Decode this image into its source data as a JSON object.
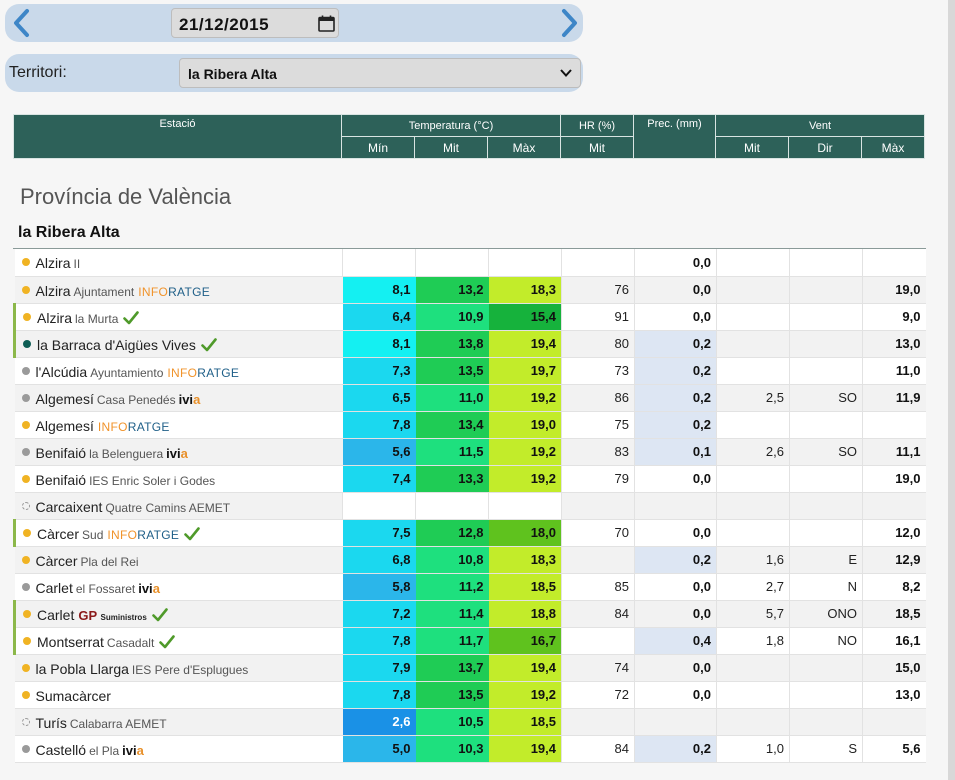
{
  "date": "21/12/2015",
  "territory": {
    "label": "Territori:",
    "selected": "la Ribera Alta"
  },
  "headers": {
    "station": "Estació",
    "temperature": "Temperatura (°C)",
    "hr": "HR (%)",
    "prec": "Prec. (mm)",
    "wind": "Vent",
    "min": "Mín",
    "mit": "Mit",
    "max": "Màx",
    "hr_mit": "Mit",
    "wind_mit": "Mit",
    "wind_dir": "Dir",
    "wind_max": "Màx"
  },
  "province": "Província de València",
  "region": "la Ribera Alta",
  "colors": {
    "header_bg": "#2d6159",
    "cyan": "#14f0f2",
    "sky": "#1bd8ef",
    "blue": "#2bb6ea",
    "deepblue": "#1a91e6",
    "green_light": "#1ee07e",
    "green": "#1fcc55",
    "green_dark": "#16b23c",
    "lime": "#c2ec2a",
    "lime_mid": "#93dc20",
    "lime_dark": "#5fc21e",
    "prec_shade": "#dde6f3"
  },
  "rows": [
    {
      "dot": "y",
      "station": "Alzira",
      "sub": "II",
      "net": "",
      "ok": false,
      "min": "",
      "mit": "",
      "max": "",
      "hr": "",
      "prec": "0,0",
      "wmit": "",
      "wdir": "",
      "wmax": "",
      "c": [
        "",
        "",
        ""
      ],
      "ps": false
    },
    {
      "dot": "y",
      "station": "Alzira",
      "sub": "Ajuntament",
      "net": "INFORATGE",
      "ok": false,
      "min": "8,1",
      "mit": "13,2",
      "max": "18,3",
      "hr": "76",
      "prec": "0,0",
      "wmit": "",
      "wdir": "",
      "wmax": "19,0",
      "c": [
        "cyan",
        "green",
        "lime"
      ],
      "ps": false
    },
    {
      "dot": "y",
      "station": "Alzira",
      "sub": "la Murta",
      "net": "",
      "ok": true,
      "min": "6,4",
      "mit": "10,9",
      "max": "15,4",
      "hr": "91",
      "prec": "0,0",
      "wmit": "",
      "wdir": "",
      "wmax": "9,0",
      "c": [
        "sky",
        "green_light",
        "green_dark"
      ],
      "ps": false
    },
    {
      "dot": "t",
      "station": "la Barraca d'Aigües Vives",
      "sub": "",
      "net": "",
      "ok": true,
      "min": "8,1",
      "mit": "13,8",
      "max": "19,4",
      "hr": "80",
      "prec": "0,2",
      "wmit": "",
      "wdir": "",
      "wmax": "13,0",
      "c": [
        "cyan",
        "green",
        "lime"
      ],
      "ps": true
    },
    {
      "dot": "g",
      "station": "l'Alcúdia",
      "sub": "Ayuntamiento",
      "net": "INFORATGE",
      "ok": false,
      "min": "7,3",
      "mit": "13,5",
      "max": "19,7",
      "hr": "73",
      "prec": "0,2",
      "wmit": "",
      "wdir": "",
      "wmax": "11,0",
      "c": [
        "sky",
        "green",
        "lime"
      ],
      "ps": true
    },
    {
      "dot": "g",
      "station": "Algemesí",
      "sub": "Casa Penedés",
      "net": "ivia",
      "ok": false,
      "min": "6,5",
      "mit": "11,0",
      "max": "19,2",
      "hr": "86",
      "prec": "0,2",
      "wmit": "2,5",
      "wdir": "SO",
      "wmax": "11,9",
      "c": [
        "sky",
        "green_light",
        "lime"
      ],
      "ps": true
    },
    {
      "dot": "y",
      "station": "Algemesí",
      "sub": "",
      "net": "INFORATGE",
      "ok": false,
      "min": "7,8",
      "mit": "13,4",
      "max": "19,0",
      "hr": "75",
      "prec": "0,2",
      "wmit": "",
      "wdir": "",
      "wmax": "",
      "c": [
        "sky",
        "green",
        "lime"
      ],
      "ps": true
    },
    {
      "dot": "g",
      "station": "Benifaió",
      "sub": "la Belenguera",
      "net": "ivia",
      "ok": false,
      "min": "5,6",
      "mit": "11,5",
      "max": "19,2",
      "hr": "83",
      "prec": "0,1",
      "wmit": "2,6",
      "wdir": "SO",
      "wmax": "11,1",
      "c": [
        "blue",
        "green_light",
        "lime"
      ],
      "ps": true
    },
    {
      "dot": "y",
      "station": "Benifaió",
      "sub": "IES Enric Soler i Godes",
      "net": "",
      "ok": false,
      "min": "7,4",
      "mit": "13,3",
      "max": "19,2",
      "hr": "79",
      "prec": "0,0",
      "wmit": "",
      "wdir": "",
      "wmax": "19,0",
      "c": [
        "sky",
        "green",
        "lime"
      ],
      "ps": false
    },
    {
      "dot": "e",
      "station": "Carcaixent",
      "sub": "Quatre Camins AEMET",
      "net": "",
      "ok": false,
      "min": "",
      "mit": "",
      "max": "",
      "hr": "",
      "prec": "",
      "wmit": "",
      "wdir": "",
      "wmax": "",
      "c": [
        "",
        "",
        ""
      ],
      "ps": false
    },
    {
      "dot": "y",
      "station": "Càrcer",
      "sub": "Sud",
      "net": "INFORATGE",
      "ok": true,
      "min": "7,5",
      "mit": "12,8",
      "max": "18,0",
      "hr": "70",
      "prec": "0,0",
      "wmit": "",
      "wdir": "",
      "wmax": "12,0",
      "c": [
        "sky",
        "green",
        "lime_dark"
      ],
      "ps": false
    },
    {
      "dot": "y",
      "station": "Càrcer",
      "sub": "Pla del Rei",
      "net": "",
      "ok": false,
      "min": "6,8",
      "mit": "10,8",
      "max": "18,3",
      "hr": "",
      "prec": "0,2",
      "wmit": "1,6",
      "wdir": "E",
      "wmax": "12,9",
      "c": [
        "sky",
        "green_light",
        "lime"
      ],
      "ps": true
    },
    {
      "dot": "g",
      "station": "Carlet",
      "sub": "el Fossaret",
      "net": "ivia",
      "ok": false,
      "min": "5,8",
      "mit": "11,2",
      "max": "18,5",
      "hr": "85",
      "prec": "0,0",
      "wmit": "2,7",
      "wdir": "N",
      "wmax": "8,2",
      "c": [
        "blue",
        "green_light",
        "lime"
      ],
      "ps": false
    },
    {
      "dot": "y",
      "station": "Carlet",
      "sub": "",
      "net": "GP",
      "ok": true,
      "min": "7,2",
      "mit": "11,4",
      "max": "18,8",
      "hr": "84",
      "prec": "0,0",
      "wmit": "5,7",
      "wdir": "ONO",
      "wmax": "18,5",
      "c": [
        "sky",
        "green_light",
        "lime"
      ],
      "ps": false
    },
    {
      "dot": "y",
      "station": "Montserrat",
      "sub": "Casadalt",
      "net": "",
      "ok": true,
      "min": "7,8",
      "mit": "11,7",
      "max": "16,7",
      "hr": "",
      "prec": "0,4",
      "wmit": "1,8",
      "wdir": "NO",
      "wmax": "16,1",
      "c": [
        "sky",
        "green_light",
        "lime_dark"
      ],
      "ps": true
    },
    {
      "dot": "y",
      "station": "la Pobla Llarga",
      "sub": "IES Pere d'Esplugues",
      "net": "",
      "ok": false,
      "min": "7,9",
      "mit": "13,7",
      "max": "19,4",
      "hr": "74",
      "prec": "0,0",
      "wmit": "",
      "wdir": "",
      "wmax": "15,0",
      "c": [
        "sky",
        "green",
        "lime"
      ],
      "ps": false
    },
    {
      "dot": "y",
      "station": "Sumacàrcer",
      "sub": "",
      "net": "",
      "ok": false,
      "min": "7,8",
      "mit": "13,5",
      "max": "19,2",
      "hr": "72",
      "prec": "0,0",
      "wmit": "",
      "wdir": "",
      "wmax": "13,0",
      "c": [
        "sky",
        "green",
        "lime"
      ],
      "ps": false
    },
    {
      "dot": "e",
      "station": "Turís",
      "sub": "Calabarra AEMET",
      "net": "",
      "ok": false,
      "min": "2,6",
      "mit": "10,5",
      "max": "18,5",
      "hr": "",
      "prec": "",
      "wmit": "",
      "wdir": "",
      "wmax": "",
      "c": [
        "deepblue",
        "green_light",
        "lime"
      ],
      "ps": false
    },
    {
      "dot": "g",
      "station": "Castelló",
      "sub": "el Pla",
      "net": "ivia",
      "ok": false,
      "min": "5,0",
      "mit": "10,3",
      "max": "19,4",
      "hr": "84",
      "prec": "0,2",
      "wmit": "1,0",
      "wdir": "S",
      "wmax": "5,6",
      "c": [
        "blue",
        "green_light",
        "lime"
      ],
      "ps": true
    }
  ]
}
